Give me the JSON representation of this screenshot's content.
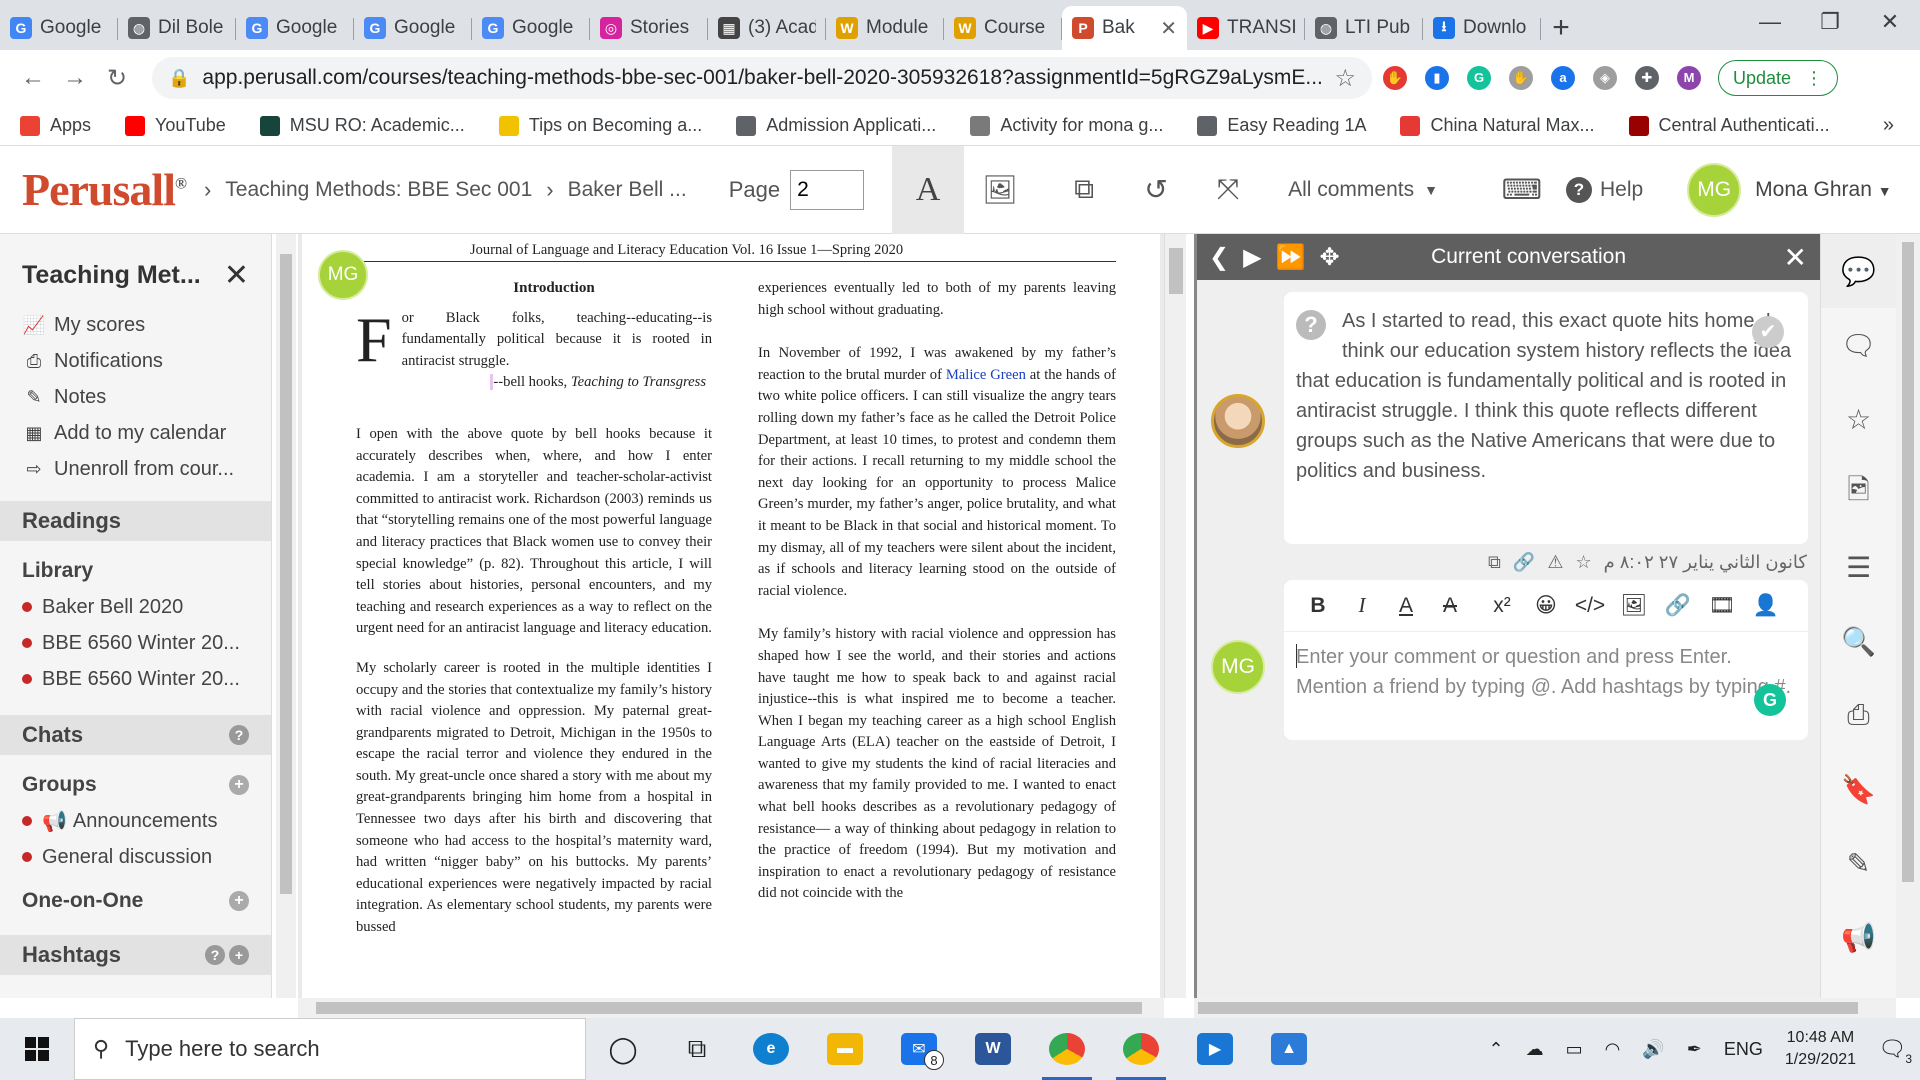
{
  "browser": {
    "tabs": [
      {
        "title": "Google",
        "color": "#4285f4",
        "glyph": "G"
      },
      {
        "title": "Dil Bole",
        "color": "#5f6368",
        "glyph": "◍"
      },
      {
        "title": "Google",
        "color": "#4c8bf5",
        "glyph": "G"
      },
      {
        "title": "Google",
        "color": "#4c8bf5",
        "glyph": "G"
      },
      {
        "title": "Google",
        "color": "#4c8bf5",
        "glyph": "G"
      },
      {
        "title": "Stories",
        "color": "#d6249f",
        "glyph": "◎"
      },
      {
        "title": "(3) Acad",
        "color": "#444444",
        "glyph": "▦"
      },
      {
        "title": "Module",
        "color": "#e0a100",
        "glyph": "W"
      },
      {
        "title": "Course",
        "color": "#e0a100",
        "glyph": "W"
      },
      {
        "title": "Bak",
        "color": "#d04a2d",
        "glyph": "P",
        "active": true
      },
      {
        "title": "TRANSI",
        "color": "#ff0000",
        "glyph": "▶"
      },
      {
        "title": "LTI Pub",
        "color": "#5f6368",
        "glyph": "◍"
      },
      {
        "title": "Downlo",
        "color": "#1a73e8",
        "glyph": "⭳"
      }
    ],
    "url": "app.perusall.com/courses/teaching-methods-bbe-sec-001/baker-bell-2020-305932618?assignmentId=5gRGZ9aLysmE...",
    "update_label": "Update",
    "profile_initial": "M",
    "bookmarks": [
      {
        "label": "Apps",
        "color": "#ea4335"
      },
      {
        "label": "YouTube",
        "color": "#ff0000"
      },
      {
        "label": "MSU RO: Academic...",
        "color": "#18453b"
      },
      {
        "label": "Tips on Becoming a...",
        "color": "#f2c200"
      },
      {
        "label": "Admission Applicati...",
        "color": "#5f6368"
      },
      {
        "label": "Activity for mona g...",
        "color": "#7a7a7a"
      },
      {
        "label": "Easy Reading 1A",
        "color": "#5f6368"
      },
      {
        "label": "China Natural Max...",
        "color": "#e53935"
      },
      {
        "label": "Central Authenticati...",
        "color": "#990000"
      }
    ]
  },
  "perusall": {
    "logo": "Perusall",
    "logo_mark": "®",
    "breadcrumb": [
      "Teaching Methods: BBE Sec 001",
      "Baker Bell ..."
    ],
    "page_label": "Page",
    "page_value": "2",
    "all_comments": "All comments",
    "help": "Help",
    "user_initials": "MG",
    "user_name": "Mona Ghran"
  },
  "sidebar": {
    "course_title": "Teaching Met...",
    "nav": [
      {
        "label": "My scores",
        "icon": "chart-icon"
      },
      {
        "label": "Notifications",
        "icon": "inbox-icon"
      },
      {
        "label": "Notes",
        "icon": "pencil-icon"
      },
      {
        "label": "Add to my calendar",
        "icon": "calendar-icon"
      },
      {
        "label": "Unenroll from cour...",
        "icon": "exit-icon"
      }
    ],
    "readings_header": "Readings",
    "library_header": "Library",
    "library_items": [
      "Baker Bell 2020",
      "BBE 6560 Winter 20...",
      "BBE 6560 Winter 20..."
    ],
    "chats_header": "Chats",
    "groups_header": "Groups",
    "groups": [
      "Announcements",
      "General discussion"
    ],
    "one_on_one": "One-on-One",
    "hashtags_header": "Hashtags"
  },
  "document": {
    "journal": "Journal of Language and Literacy Education Vol. 16 Issue 1—Spring 2020",
    "heading": "Introduction",
    "dropcap": "F",
    "quote": "or Black folks, teaching--educating--is fundamentally political because it is rooted in antiracist struggle.",
    "attribution_prefix": "--bell hooks, ",
    "attribution_title": "Teaching to Transgress",
    "col1_paragraphs": [
      "I open with the above quote by bell hooks because it accurately describes when, where, and how I enter academia. I am a storyteller and teacher-scholar-activist committed to antiracist work. Richardson (2003) reminds us that “storytelling remains one of the most powerful language and literacy practices that Black women use to convey their special knowledge” (p. 82). Throughout this article, I will tell stories about histories, personal encounters, and my teaching and research experiences as a way to reflect on the urgent need for an antiracist language and literacy education.",
      "My scholarly career is rooted in the multiple identities I occupy and the stories that contextualize my family’s history with racial violence and oppression. My paternal great-grandparents migrated to Detroit, Michigan in the 1950s to escape the racial terror and violence they endured in the south. My great-uncle once shared a story with me about my great-grandparents bringing him home from a hospital in Tennessee two days after his birth and discovering that someone who had access to the hospital’s maternity ward, had written “nigger baby” on his buttocks. My parents’ educational experiences were negatively impacted by racial integration. As elementary school students, my parents were bussed"
    ],
    "col2_first": "experiences eventually led to both of my parents leaving high school without graduating.",
    "col2_p2_a": "In November of 1992, I was awakened by my father’s reaction to the brutal murder of ",
    "col2_p2_link": "Malice Green",
    "col2_p2_b": " at the hands of two white police officers. I can still visualize the angry tears rolling down my father’s face as he called the Detroit Police Department, at least 10 times, to protest and condemn them for their actions. I recall returning to my middle school the next day looking for an opportunity to process Malice Green’s murder, my father’s anger, police brutality, and what it meant to be Black in that social and historical moment. To my dismay, all of my teachers were silent about the incident, as if schools and literacy learning stood on the outside of racial violence.",
    "col2_p3": "My family’s history with racial violence and oppression has shaped how I see the world, and their stories and actions have taught me how to speak back to and against racial injustice--this is what inspired me to become a teacher. When I began my teaching career as a high school English Language Arts (ELA) teacher on the eastside of Detroit, I wanted to give my students the kind of racial literacies and awareness that my family provided to me. I wanted to enact what bell hooks describes as a revolutionary pedagogy of resistance— a way of thinking about pedagogy in relation to the practice of freedom (1994). But my motivation and inspiration to enact a revolutionary pedagogy of resistance did not coincide with the"
  },
  "conversation": {
    "title": "Current conversation",
    "comment": "As I started to read, this exact quote hits home. I think our education system history reflects the idea that education is fundamentally political and is rooted in antiracist struggle. I think this quote reflects different groups such as the Native Americans that were due to politics and business.",
    "comment_date": "كانون الثاني يناير ٢٧ ٨:٠٢ م",
    "placeholder": "Enter your comment or question and press Enter. Mention a friend by typing @. Add hashtags by typing #.",
    "reply_initials": "MG"
  },
  "taskbar": {
    "search_placeholder": "Type here to search",
    "mail_badge": "8",
    "language": "ENG",
    "time": "10:48 AM",
    "date": "1/29/2021",
    "notification_count": "3"
  }
}
